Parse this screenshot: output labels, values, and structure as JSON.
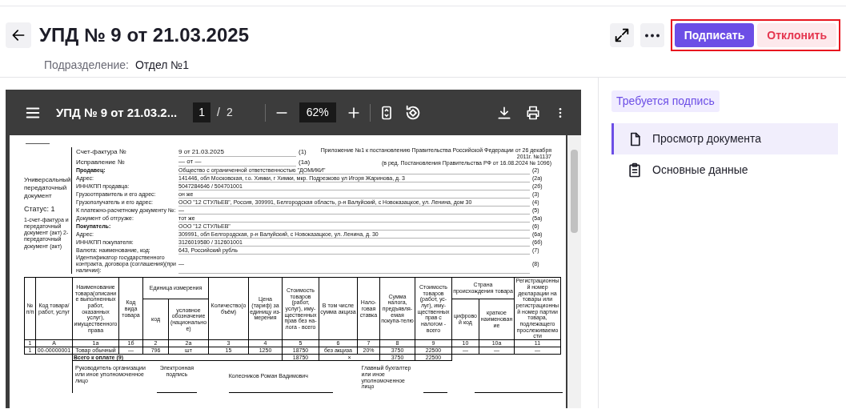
{
  "page_header": {
    "title": "УПД № 9 от 21.03.2025",
    "subdivision_label": "Подразделение:",
    "subdivision": "Отдел №1"
  },
  "actions": {
    "highlighted": true,
    "buttons": [
      {
        "label": "Подписать",
        "kind": "primary"
      },
      {
        "label": "Отклонить",
        "kind": "danger"
      }
    ]
  },
  "viewer": {
    "title": "УПД № 9 от 21.03.2...",
    "page": "1",
    "separator": "/",
    "pages": "2",
    "zoom": "62%"
  },
  "document": {
    "side_title": "Универсальный передаточный документ",
    "status": "Статус: 1",
    "status_note": "1-счет-фактура и передаточный документ (акт) 2-передаточный документ (акт)",
    "appendix": [
      "Приложение №1 к постановлению Правительства Российской Федерации от 26 декабря 2011г. №1137",
      "(в ред. Постановления Правительства РФ от 16.08.2024 № 1096)"
    ],
    "fields": [
      {
        "label": "Счет-фактура №",
        "value": "9 от 21.03.2025",
        "code": "(1)",
        "bold": false,
        "short": true
      },
      {
        "label": "Исправление №",
        "value": "— от —",
        "code": "(1а)",
        "bold": false,
        "short": true
      },
      {
        "label": "Продавец:",
        "value": "Общество с ограниченной ответственностью \"ДОМИКИ\"",
        "code": "(2)",
        "bold": true,
        "short": false
      },
      {
        "label": "Адрес:",
        "value": "141446, обл Московская, г.о. Химки, г Химки, мкр. Подрезково ул Игоря Жаринова, д. 3",
        "code": "(2а)",
        "bold": false,
        "short": false
      },
      {
        "label": "ИНН/КПП продавца:",
        "value": "5047284646 / 504701001",
        "code": "(2б)",
        "bold": false,
        "short": false
      },
      {
        "label": "Грузоотправитель и его адрес:",
        "value": "он же",
        "code": "(3)",
        "bold": false,
        "short": false
      },
      {
        "label": "Грузополучатель и его адрес:",
        "value": "ООО \"12 СТУЛЬЕВ\", Россия, 309991, Белгородская область, р-н Валуйский, с Новоказацкое, ул. Ленина, дом 30",
        "code": "(4)",
        "bold": false,
        "short": false
      },
      {
        "label": "К платежно-расчетному документу №:",
        "value": "—",
        "code": "(5)",
        "bold": false,
        "short": false
      },
      {
        "label": "Документ об отгрузке:",
        "value": "тот же",
        "code": "(5а)",
        "bold": false,
        "short": false
      },
      {
        "label": "Покупатель:",
        "value": "ООО \"12 СТУЛЬЕВ\"",
        "code": "(6)",
        "bold": true,
        "short": false
      },
      {
        "label": "Адрес:",
        "value": "309991, обл Белгородская, р-н Валуйский, с Новоказацкое, ул. Ленина, д. 30",
        "code": "(6а)",
        "bold": false,
        "short": false
      },
      {
        "label": "ИНН/КПП покупателя:",
        "value": "3126019580 / 312601001",
        "code": "(6б)",
        "bold": false,
        "short": false
      },
      {
        "label": "Валюта: наименование, код:",
        "value": "643, Российский рубль",
        "code": "(7)",
        "bold": false,
        "short": false
      },
      {
        "label": "Идентификатор государственного контракта, договора (соглашения)(при наличии):",
        "value": "—",
        "code": "(8)",
        "bold": false,
        "short": false
      }
    ],
    "table": {
      "header_rows": [
        [
          {
            "text": "№ п/п",
            "rowspan": 2
          },
          {
            "text": "Код товара/ работ, услуг",
            "rowspan": 2
          },
          {
            "text": "Наименование товара(описание выполненных работ, оказанных услуг), имущественного права",
            "rowspan": 2
          },
          {
            "text": "Код вида товара",
            "rowspan": 2
          },
          {
            "text": "Единица измерения",
            "colspan": 2
          },
          {
            "text": "Количество(объём)",
            "rowspan": 2
          },
          {
            "text": "Цена (тариф) за единицу из-мерения",
            "rowspan": 2
          },
          {
            "text": "Стоимость товаров (работ, услуг), иму-щественных прав без на-лога - всего",
            "rowspan": 2
          },
          {
            "text": "В том числе сумма акциза",
            "rowspan": 2
          },
          {
            "text": "Нало-говая ставка",
            "rowspan": 2
          },
          {
            "text": "Сумма налога, предъявля-емая покупа-телю",
            "rowspan": 2
          },
          {
            "text": "Стоимость товаров (работ, ус-луг), иму-щественных прав с налогом - всего",
            "rowspan": 2
          },
          {
            "text": "Страна происхождения товара",
            "colspan": 2
          },
          {
            "text": "Регистрационный номер декларации на товары или регистрационный номер партии товара, подлежащего прослеживаемости",
            "rowspan": 2
          }
        ],
        [
          {
            "text": "код"
          },
          {
            "text": "условное обозначение (национальное)"
          },
          {
            "text": "цифровой код"
          },
          {
            "text": "краткое наименование"
          }
        ]
      ],
      "numbers": [
        "1",
        "А",
        "1а",
        "1б",
        "2",
        "2а",
        "3",
        "4",
        "5",
        "6",
        "7",
        "8",
        "9",
        "10",
        "10а",
        "11"
      ],
      "rows": [
        [
          "1",
          "00-00000001",
          "Товар обычный",
          "—",
          "796",
          "шт",
          "15",
          "1250",
          "18750",
          "без акциза",
          "20%",
          "3750",
          "22500",
          "—",
          "—",
          "—"
        ]
      ],
      "total": [
        {
          "text": "Всего к оплате (9)",
          "colspan": 6
        },
        {
          "text": "18750"
        },
        {
          "text": "×",
          "colspan": 2
        },
        {
          "text": "3750"
        },
        {
          "text": "22500"
        }
      ]
    },
    "signatures": {
      "head_role": "Руководитель организации или иное уполномоченное лицо",
      "sign": "Электронная подпись",
      "head_name": "Колесников Роман Вадимович",
      "accountant_role": "Главный бухгалтер или иное уполномоченное лицо"
    }
  },
  "sidebar": {
    "badge": "Требуется подпись",
    "items": [
      {
        "label": "Просмотр документа",
        "selected": true,
        "kind": "document"
      },
      {
        "label": "Основные данные",
        "selected": false,
        "kind": "clipboard"
      }
    ]
  }
}
